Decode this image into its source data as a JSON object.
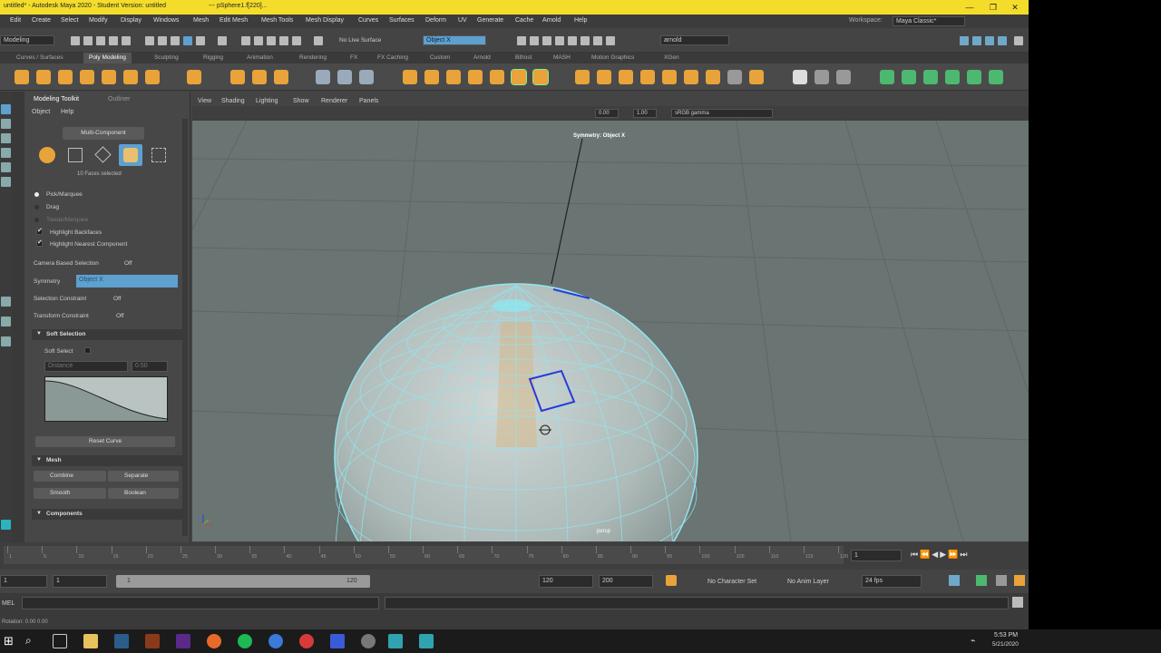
{
  "window": {
    "title": "untitled* - Autodesk Maya 2020 - Student Version: untitled",
    "path": "--- pSphere1.f[220]...",
    "minimize": "—",
    "maximize": "❐",
    "close": "✕"
  },
  "menus": [
    "Edit",
    "Create",
    "Select",
    "Modify",
    "Display",
    "Windows",
    "Mesh",
    "Edit Mesh",
    "Mesh Tools",
    "Mesh Display",
    "Curves",
    "Surfaces",
    "Deform",
    "UV",
    "Generate",
    "Cache",
    "Arnold",
    "Help"
  ],
  "workspace": {
    "label": "Workspace:",
    "value": "Maya Classic*"
  },
  "statusline": {
    "mode": "Modeling",
    "live_surface": "No Live Surface",
    "symmetry_field": "Object X",
    "renderer": "arnold"
  },
  "shelf_tabs": [
    "Curves / Surfaces",
    "Poly Modeling",
    "Sculpting",
    "Rigging",
    "Animation",
    "Rendering",
    "FX",
    "FX Caching",
    "Custom",
    "Arnold",
    "Bifrost",
    "MASH",
    "Motion Graphics",
    "XGen"
  ],
  "shelf_active": "Poly Modeling",
  "toolkit": {
    "tabs": [
      "Modeling Toolkit",
      "Outliner"
    ],
    "menu": [
      "Object",
      "Help"
    ],
    "multi_component": "Multi-Component",
    "selected_count": "10 Faces selected",
    "options": [
      {
        "label": "Pick/Marquee",
        "checked": false,
        "radio": true
      },
      {
        "label": "Drag",
        "checked": false,
        "radio": true
      },
      {
        "label": "Tweak/Marquee",
        "checked": false,
        "radio": true
      },
      {
        "label": "Highlight Backfaces",
        "checked": true
      },
      {
        "label": "Highlight Nearest Component",
        "checked": true
      }
    ],
    "camera_selection": {
      "label": "Camera Based Selection",
      "value": "Off"
    },
    "symmetry": {
      "label": "Symmetry",
      "value": "Object X"
    },
    "selection_constraint": {
      "label": "Selection Constraint",
      "value": "Off"
    },
    "transform_constraint": {
      "label": "Transform Constraint",
      "value": "Off"
    },
    "soft_selection": "Soft Selection",
    "soft_select": "Soft Select",
    "falloff": "Distance",
    "falloff_value": "0.50",
    "reset_curve": "Reset Curve",
    "mesh_section": "Mesh",
    "mesh_buttons": [
      "Combine",
      "Separate",
      "Smooth",
      "Boolean"
    ],
    "components_section": "Components"
  },
  "viewport": {
    "menu": [
      "View",
      "Shading",
      "Lighting",
      "Show",
      "Renderer",
      "Panels"
    ],
    "exposure": "0.00",
    "gamma": "1.00",
    "colorspace": "sRGB gamma",
    "symmetry_label": "Symmetry: Object X",
    "camera": "persp"
  },
  "timeline": {
    "ticks": [
      "1",
      "5",
      "10",
      "15",
      "20",
      "25",
      "30",
      "35",
      "40",
      "45",
      "50",
      "55",
      "60",
      "65",
      "70",
      "75",
      "80",
      "85",
      "90",
      "95",
      "100",
      "105",
      "110",
      "115",
      "120"
    ],
    "current_frame": "1"
  },
  "range": {
    "start": "1",
    "inner_start": "1",
    "slider_start": "1",
    "slider_end": "120",
    "end": "120",
    "outer_end": "200",
    "character_set": "No Character Set",
    "anim_layer": "No Anim Layer",
    "fps": "24 fps"
  },
  "cmdline": {
    "lang": "MEL"
  },
  "helpline": {
    "text": "Rotation:   0.00   0.00"
  },
  "taskbar": {
    "time": "5:53 PM",
    "date": "5/21/2020"
  },
  "colors": {
    "titlebar": "#f4dd2a",
    "accent": "#5ea0d0",
    "viewport": "#6a7473",
    "wireframe": "#8fe6f0"
  }
}
